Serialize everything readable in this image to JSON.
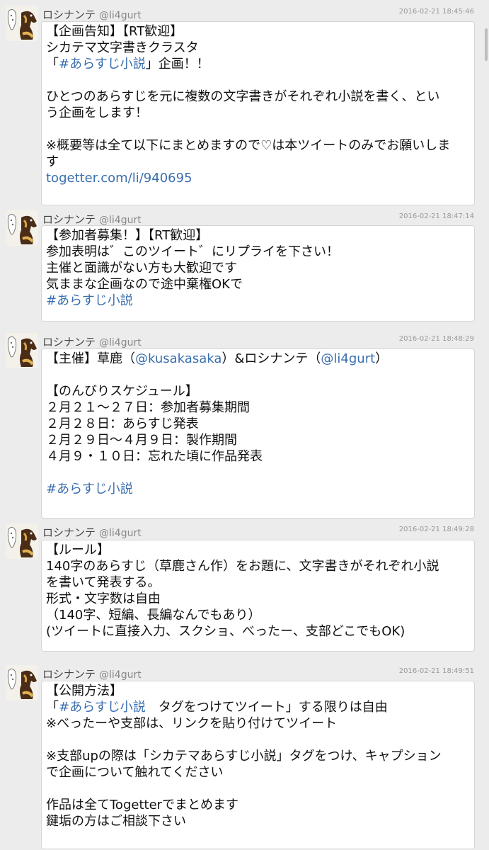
{
  "tweets": [
    {
      "name": "ロシナンテ",
      "handle": "@li4gurt",
      "time": "2016-02-21 18:45:46",
      "lines": [
        {
          "parts": [
            {
              "t": "【企画告知】【RT歓迎】"
            }
          ]
        },
        {
          "parts": [
            {
              "t": "シカテマ文字書きクラスタ"
            }
          ]
        },
        {
          "parts": [
            {
              "t": "「"
            },
            {
              "t": "#あらすじ小説",
              "link": true
            },
            {
              "t": "」企画！！"
            }
          ]
        },
        {
          "parts": [
            {
              "t": ""
            }
          ]
        },
        {
          "parts": [
            {
              "t": "ひとつのあらすじを元に複数の文字書きがそれぞれ小説を書く、とい"
            }
          ]
        },
        {
          "parts": [
            {
              "t": "う企画をします！"
            }
          ]
        },
        {
          "parts": [
            {
              "t": ""
            }
          ]
        },
        {
          "parts": [
            {
              "t": "※概要等は全て以下にまとめますので♡は本ツイートのみでお願いしま"
            }
          ]
        },
        {
          "parts": [
            {
              "t": "す"
            }
          ]
        },
        {
          "parts": [
            {
              "t": "togetter.com/li/940695",
              "link": true
            }
          ]
        }
      ]
    },
    {
      "name": "ロシナンテ",
      "handle": "@li4gurt",
      "time": "2016-02-21 18:47:14",
      "lines": [
        {
          "parts": [
            {
              "t": "【参加者募集！】【RT歓迎】"
            }
          ]
        },
        {
          "parts": [
            {
              "t": "参加表明は゛このツイート゛にリプライを下さい！"
            }
          ]
        },
        {
          "parts": [
            {
              "t": "主催と面識がない方も大歓迎です"
            }
          ]
        },
        {
          "parts": [
            {
              "t": "気ままな企画なので途中棄権OKで"
            }
          ]
        },
        {
          "parts": [
            {
              "t": "#あらすじ小説",
              "link": true
            }
          ]
        }
      ]
    },
    {
      "name": "ロシナンテ",
      "handle": "@li4gurt",
      "time": "2016-02-21 18:48:29",
      "lines": [
        {
          "parts": [
            {
              "t": "【主催】草鹿（"
            },
            {
              "t": "@kusakasaka",
              "link": true
            },
            {
              "t": "）&ロシナンテ（"
            },
            {
              "t": "@li4gurt",
              "link": true
            },
            {
              "t": "）"
            }
          ]
        },
        {
          "parts": [
            {
              "t": ""
            }
          ]
        },
        {
          "parts": [
            {
              "t": "【のんびりスケジュール】"
            }
          ]
        },
        {
          "parts": [
            {
              "t": "２月２１～２７日：参加者募集期間"
            }
          ]
        },
        {
          "parts": [
            {
              "t": "２月２８日：あらすじ発表"
            }
          ]
        },
        {
          "parts": [
            {
              "t": "２月２９日～４月９日：製作期間"
            }
          ]
        },
        {
          "parts": [
            {
              "t": "４月９・１０日：忘れた頃に作品発表"
            }
          ]
        },
        {
          "parts": [
            {
              "t": ""
            }
          ]
        },
        {
          "parts": [
            {
              "t": "#あらすじ小説",
              "link": true
            }
          ]
        }
      ]
    },
    {
      "name": "ロシナンテ",
      "handle": "@li4gurt",
      "time": "2016-02-21 18:49:28",
      "lines": [
        {
          "parts": [
            {
              "t": "【ルール】"
            }
          ]
        },
        {
          "parts": [
            {
              "t": "140字のあらすじ（草鹿さん作）をお題に、文字書きがそれぞれ小説"
            }
          ]
        },
        {
          "parts": [
            {
              "t": "を書いて発表する。"
            }
          ]
        },
        {
          "parts": [
            {
              "t": "形式・文字数は自由"
            }
          ]
        },
        {
          "parts": [
            {
              "t": "（140字、短編、長編なんでもあり）"
            }
          ]
        },
        {
          "parts": [
            {
              "t": "(ツイートに直接入力、スクショ、べったー、支部どこでもOK)"
            }
          ]
        }
      ]
    },
    {
      "name": "ロシナンテ",
      "handle": "@li4gurt",
      "time": "2016-02-21 18:49:51",
      "lines": [
        {
          "parts": [
            {
              "t": "【公開方法】"
            }
          ]
        },
        {
          "parts": [
            {
              "t": "「"
            },
            {
              "t": "#あらすじ小説",
              "link": true
            },
            {
              "t": "　タグをつけてツイート」する限りは自由"
            }
          ]
        },
        {
          "parts": [
            {
              "t": "※べったーや支部は、リンクを貼り付けてツイート"
            }
          ]
        },
        {
          "parts": [
            {
              "t": ""
            }
          ]
        },
        {
          "parts": [
            {
              "t": "※支部upの際は「シカテマあらすじ小説」タグをつけ、キャプション"
            }
          ]
        },
        {
          "parts": [
            {
              "t": "で企画について触れてください"
            }
          ]
        },
        {
          "parts": [
            {
              "t": ""
            }
          ]
        },
        {
          "parts": [
            {
              "t": "作品は全てTogetterでまとめます"
            }
          ]
        },
        {
          "parts": [
            {
              "t": "鍵垢の方はご相談下さい"
            }
          ]
        }
      ]
    }
  ]
}
